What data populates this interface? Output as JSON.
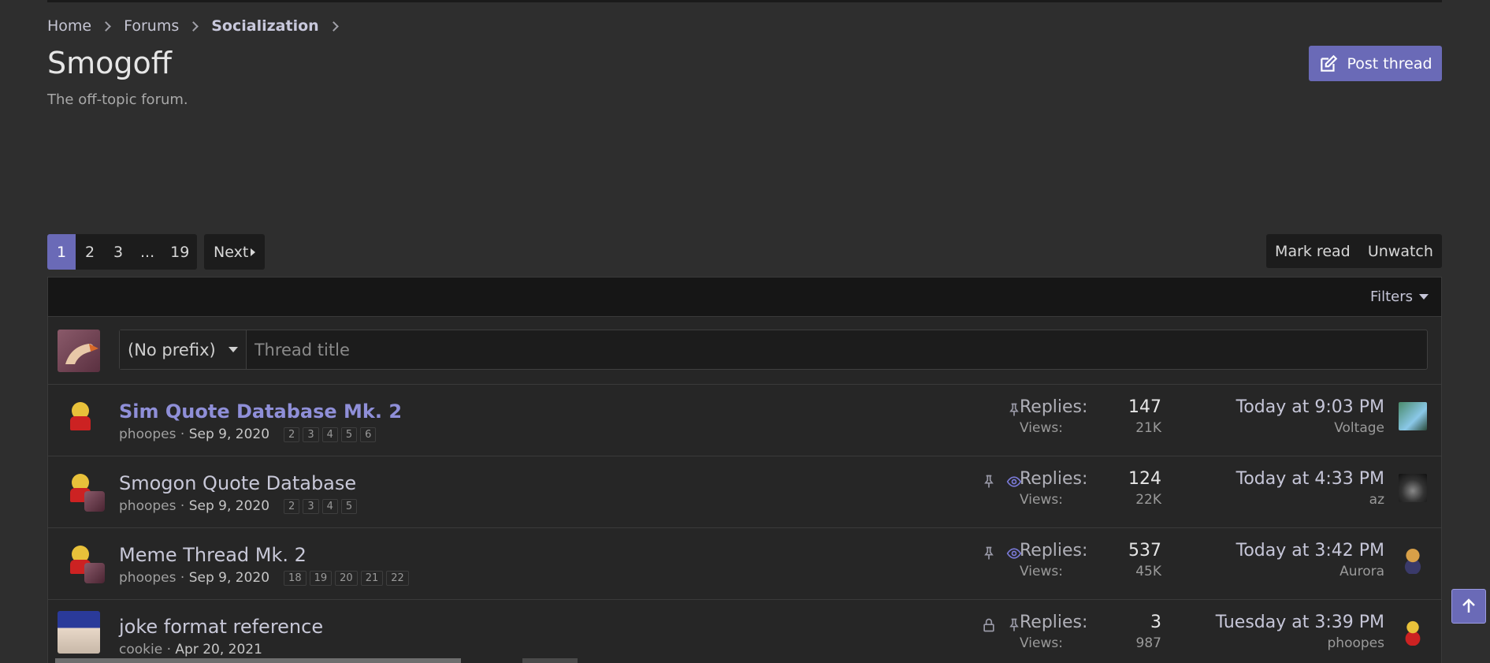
{
  "breadcrumb": [
    "Home",
    "Forums",
    "Socialization"
  ],
  "page": {
    "title": "Smogoff",
    "description": "The off-topic forum."
  },
  "post_button": "Post thread",
  "pagination": {
    "pages": [
      "1",
      "2",
      "3",
      "...",
      "19"
    ],
    "current": "1",
    "next": "Next"
  },
  "actions": {
    "mark_read": "Mark read",
    "unwatch": "Unwatch"
  },
  "filters": "Filters",
  "quick_thread": {
    "prefix": "(No prefix)",
    "placeholder": "Thread title"
  },
  "colors": {
    "accent": "#6a6ab7",
    "background": "#2e2e2e",
    "unread_title": "#8f8fd8"
  },
  "threads": [
    {
      "title": "Sim Quote Database Mk. 2",
      "author": "phoopes",
      "date": "Sep 9, 2020",
      "pages": [
        "2",
        "3",
        "4",
        "5",
        "6"
      ],
      "icons": [
        "pin-icon"
      ],
      "replies_label": "Replies:",
      "replies": "147",
      "views_label": "Views:",
      "views": "21K",
      "last_time": "Today at 9:03 PM",
      "last_user": "Voltage"
    },
    {
      "title": "Smogon Quote Database",
      "author": "phoopes",
      "date": "Sep 9, 2020",
      "pages": [
        "2",
        "3",
        "4",
        "5"
      ],
      "icons": [
        "pin-icon",
        "eye-icon"
      ],
      "replies_label": "Replies:",
      "replies": "124",
      "views_label": "Views:",
      "views": "22K",
      "last_time": "Today at 4:33 PM",
      "last_user": "az"
    },
    {
      "title": "Meme Thread Mk. 2",
      "author": "phoopes",
      "date": "Sep 9, 2020",
      "pages": [
        "18",
        "19",
        "20",
        "21",
        "22"
      ],
      "icons": [
        "pin-icon",
        "eye-icon"
      ],
      "replies_label": "Replies:",
      "replies": "537",
      "views_label": "Views:",
      "views": "45K",
      "last_time": "Today at 3:42 PM",
      "last_user": "Aurora"
    },
    {
      "title": "joke format reference",
      "author": "cookie",
      "date": "Apr 20, 2021",
      "pages": [],
      "icons": [
        "lock-icon",
        "pin-icon"
      ],
      "replies_label": "Replies:",
      "replies": "3",
      "views_label": "Views:",
      "views": "987",
      "last_time": "Tuesday at 3:39 PM",
      "last_user": "phoopes"
    }
  ]
}
